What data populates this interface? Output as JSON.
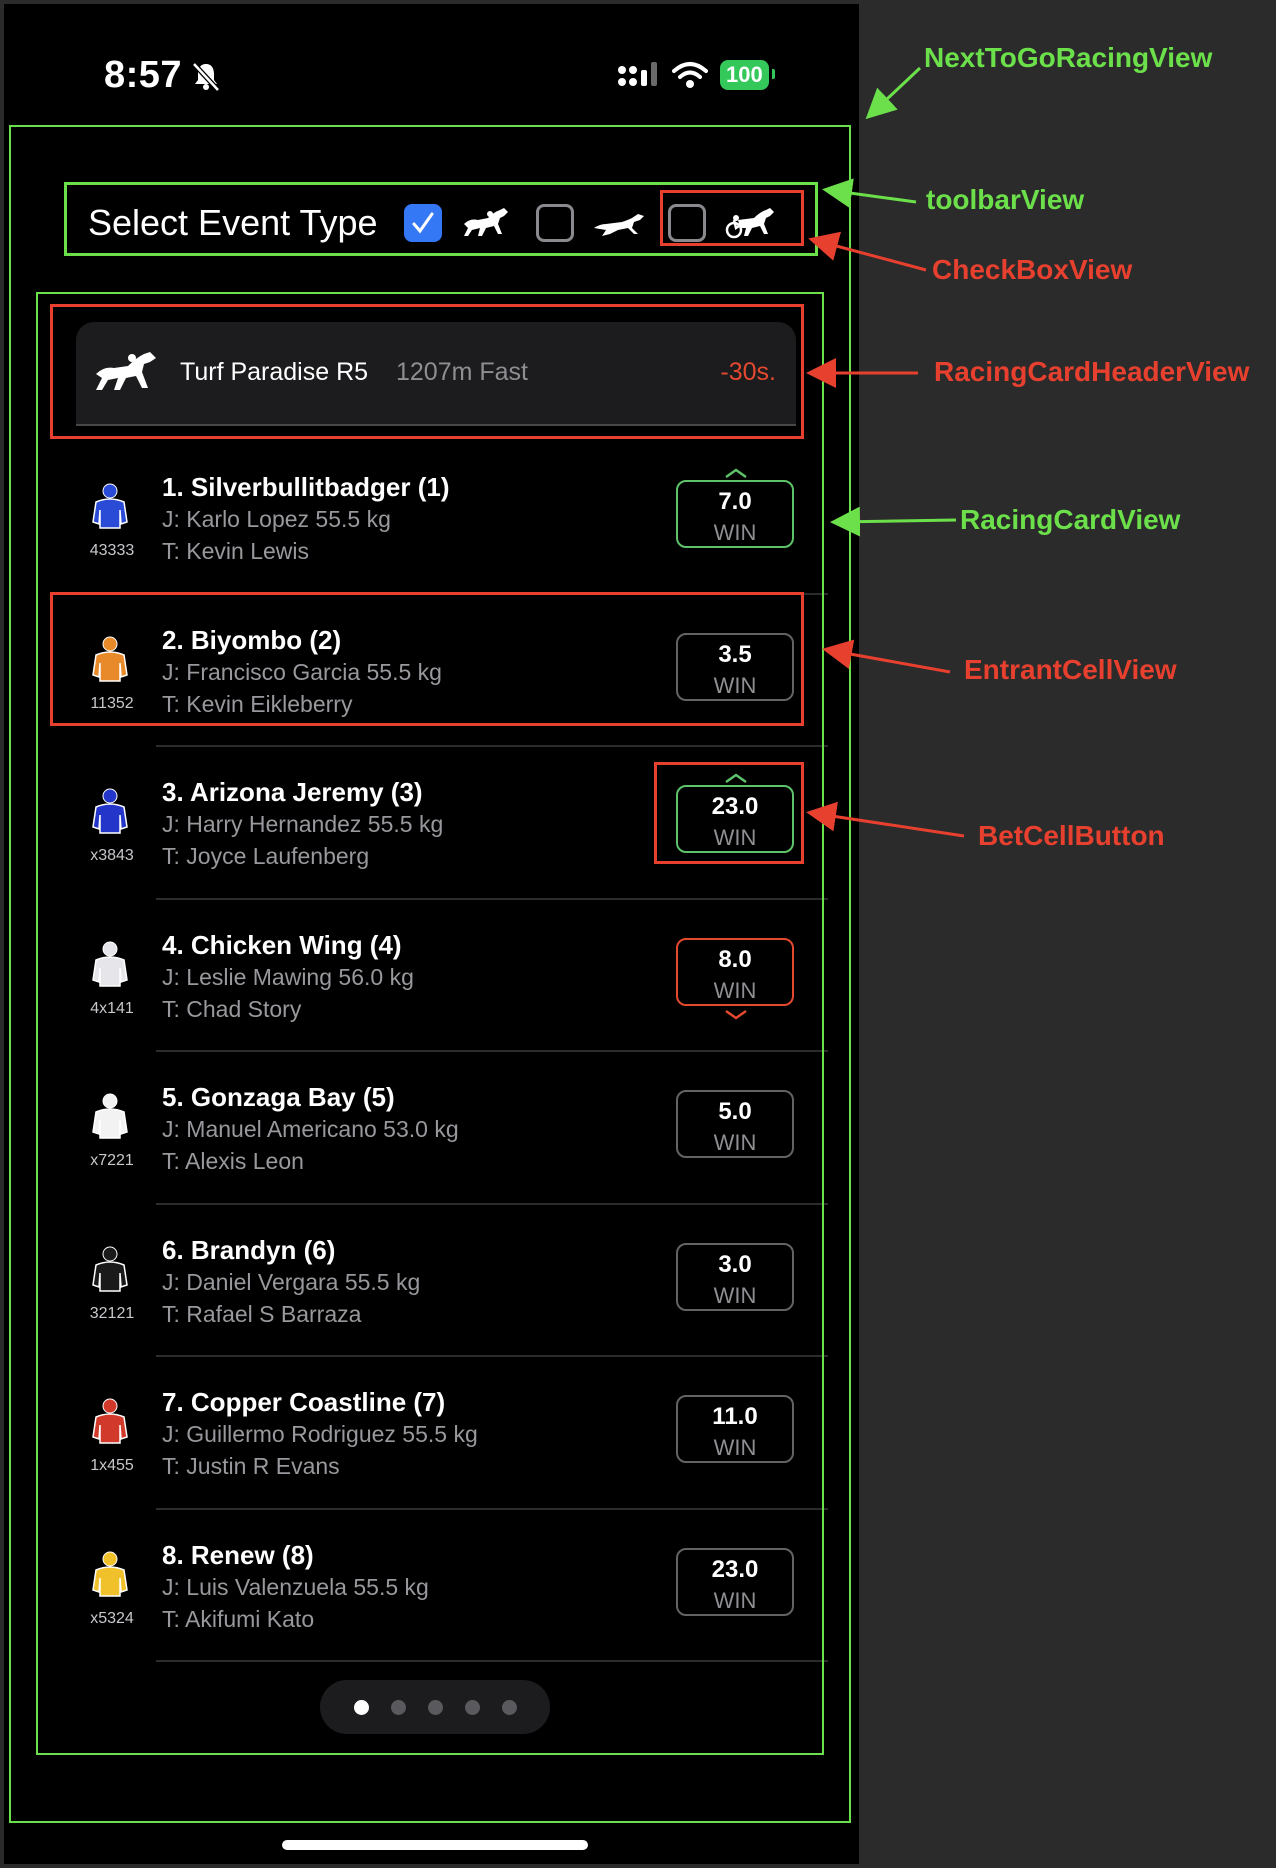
{
  "status_bar": {
    "time": "8:57",
    "battery": "100"
  },
  "toolbar": {
    "label": "Select Event Type",
    "checkboxes": [
      {
        "type": "horse-racing",
        "checked": true
      },
      {
        "type": "greyhound-racing",
        "checked": false
      },
      {
        "type": "harness-racing",
        "checked": false
      }
    ]
  },
  "race": {
    "name": "Turf Paradise R5",
    "distance": "1207m Fast",
    "countdown": "-30s."
  },
  "entrants": [
    {
      "name": "1. Silverbullitbadger (1)",
      "jockey": "J: Karlo Lopez 55.5 kg",
      "trainer": "T: Kevin Lewis",
      "form": "43333",
      "odds": "7.0",
      "bet_type": "WIN",
      "trend": "up",
      "silk_color": "#2a4bd6"
    },
    {
      "name": "2. Biyombo (2)",
      "jockey": "J: Francisco Garcia 55.5 kg",
      "trainer": "T: Kevin Eikleberry",
      "form": "11352",
      "odds": "3.5",
      "bet_type": "WIN",
      "trend": "none",
      "silk_color": "#e88a2a"
    },
    {
      "name": "3. Arizona Jeremy (3)",
      "jockey": "J: Harry Hernandez 55.5 kg",
      "trainer": "T: Joyce Laufenberg",
      "form": "x3843",
      "odds": "23.0",
      "bet_type": "WIN",
      "trend": "up",
      "silk_color": "#2436c9"
    },
    {
      "name": "4. Chicken Wing (4)",
      "jockey": "J: Leslie Mawing 56.0 kg",
      "trainer": "T: Chad Story",
      "form": "4x141",
      "odds": "8.0",
      "bet_type": "WIN",
      "trend": "down",
      "silk_color": "#e5e5ea"
    },
    {
      "name": "5. Gonzaga Bay (5)",
      "jockey": "J: Manuel Americano 53.0 kg",
      "trainer": "T: Alexis Leon",
      "form": "x7221",
      "odds": "5.0",
      "bet_type": "WIN",
      "trend": "none",
      "silk_color": "#f2f2f2"
    },
    {
      "name": "6. Brandyn (6)",
      "jockey": "J: Daniel Vergara 55.5 kg",
      "trainer": "T: Rafael S Barraza",
      "form": "32121",
      "odds": "3.0",
      "bet_type": "WIN",
      "trend": "none",
      "silk_color": "#1a1a1a"
    },
    {
      "name": "7. Copper Coastline (7)",
      "jockey": "J: Guillermo Rodriguez 55.5 kg",
      "trainer": "T: Justin R Evans",
      "form": "1x455",
      "odds": "11.0",
      "bet_type": "WIN",
      "trend": "none",
      "silk_color": "#d13a2a"
    },
    {
      "name": "8. Renew (8)",
      "jockey": "J: Luis Valenzuela 55.5 kg",
      "trainer": "T: Akifumi Kato",
      "form": "x5324",
      "odds": "23.0",
      "bet_type": "WIN",
      "trend": "none",
      "silk_color": "#f0c12a"
    }
  ],
  "pager": {
    "count": 5,
    "active": 0
  },
  "annotations": {
    "next_to_go": "NextToGoRacingView",
    "toolbar_view": "toolbarView",
    "checkbox_view": "CheckBoxView",
    "header_view": "RacingCardHeaderView",
    "card_view": "RacingCardView",
    "entrant_view": "EntrantCellView",
    "bet_button": "BetCellButton"
  },
  "colors": {
    "green_annotation": "#6ce04a",
    "red_annotation": "#e8402f",
    "checkbox_blue": "#3478f6",
    "odds_up": "#5ec26a",
    "odds_down": "#e3492e"
  }
}
